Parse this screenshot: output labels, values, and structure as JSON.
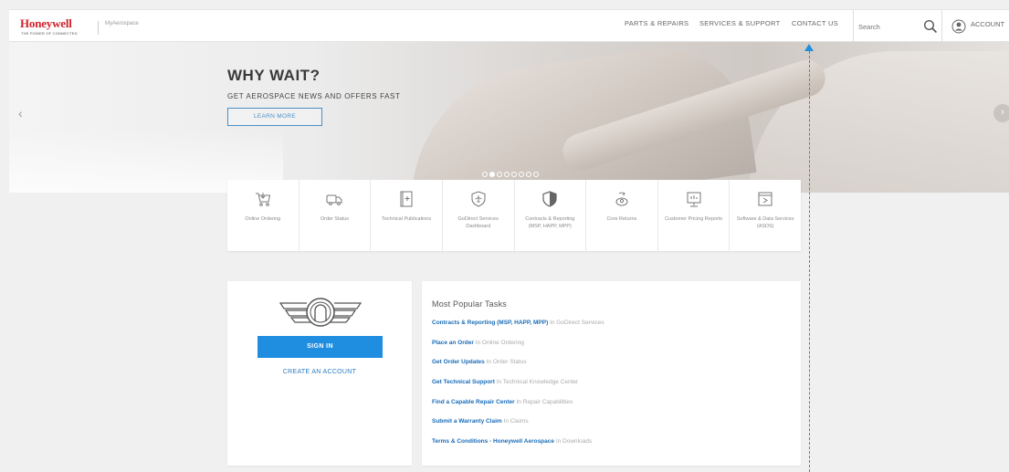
{
  "header": {
    "brand": "Honeywell",
    "brand_tagline": "THE POWER OF CONNECTED",
    "site_name": "MyAerospace",
    "nav": [
      "PARTS & REPAIRS",
      "SERVICES & SUPPORT",
      "CONTACT US"
    ],
    "search_placeholder": "Search",
    "account_label": "ACCOUNT"
  },
  "hero": {
    "title": "WHY WAIT?",
    "subtitle": "GET AEROSPACE NEWS AND OFFERS FAST",
    "cta_label": "LEARN MORE",
    "prev_glyph": "‹",
    "next_glyph": "›",
    "slide_count": 8,
    "active_slide": 1
  },
  "tiles": [
    {
      "label": "Online Ordering",
      "icon": "cart-icon"
    },
    {
      "label": "Order Status",
      "icon": "truck-icon"
    },
    {
      "label": "Technical Publications",
      "icon": "book-icon"
    },
    {
      "label": "GoDirect Services Dashboard",
      "icon": "plane-shield-icon"
    },
    {
      "label": "Contracts & Reporting (MSP, HAPP, MPP)",
      "icon": "shield-icon"
    },
    {
      "label": "Core Returns",
      "icon": "core-return-icon"
    },
    {
      "label": "Customer Pricing Reports",
      "icon": "pricing-report-icon"
    },
    {
      "label": "Software & Data Services (ASDS)",
      "icon": "software-icon"
    }
  ],
  "account_card": {
    "signin_label": "SIGN IN",
    "create_label": "CREATE AN ACCOUNT"
  },
  "popular": {
    "title": "Most Popular Tasks",
    "tasks": [
      {
        "name": "Contracts & Reporting (MSP, HAPP, MPP)",
        "location": "In GoDirect Services"
      },
      {
        "name": "Place an Order",
        "location": "In Online Ordering"
      },
      {
        "name": "Get Order Updates",
        "location": "In Order Status"
      },
      {
        "name": "Get Technical Support",
        "location": "In Technical Knowledge Center"
      },
      {
        "name": "Find a Capable Repair Center",
        "location": "In Repair Capabilities"
      },
      {
        "name": "Submit a Warranty Claim",
        "location": "In Claims"
      },
      {
        "name": "Terms & Conditions - Honeywell Aerospace",
        "location": "In Downloads"
      }
    ]
  },
  "colors": {
    "brand_red": "#d1222b",
    "accent_blue": "#1f8ee0",
    "link_blue": "#1a6db8"
  }
}
